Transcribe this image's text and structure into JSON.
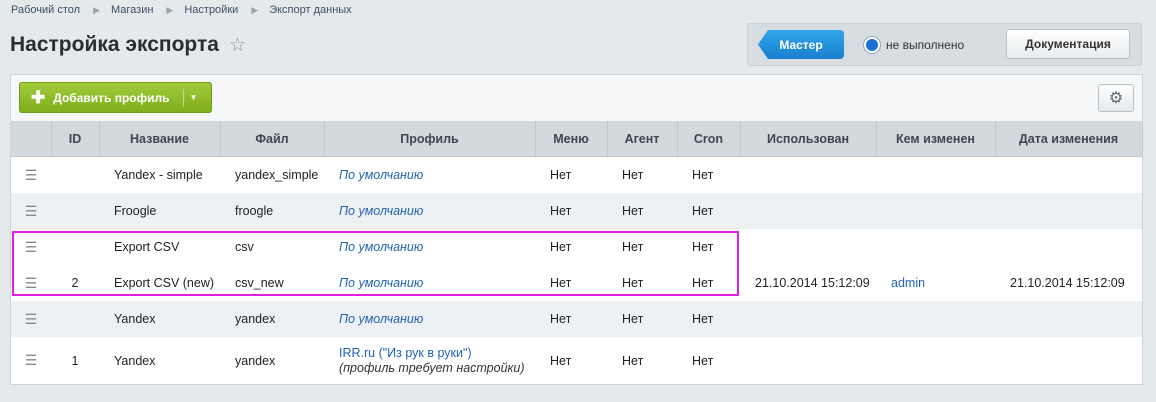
{
  "breadcrumb": [
    "Рабочий стол",
    "Магазин",
    "Настройки",
    "Экспорт данных"
  ],
  "page_title": "Настройка экспорта",
  "topbar": {
    "master_label": "Мастер",
    "status_label": "не выполнено",
    "doc_label": "Документация"
  },
  "toolbar": {
    "add_label": "Добавить профиль"
  },
  "columns": {
    "id": "ID",
    "name": "Название",
    "file": "Файл",
    "profile": "Профиль",
    "menu": "Меню",
    "agent": "Агент",
    "cron": "Cron",
    "used": "Использован",
    "changed_by": "Кем изменен",
    "changed_date": "Дата изменения"
  },
  "rows": [
    {
      "id": "",
      "name": "Yandex - simple",
      "file": "yandex_simple",
      "profile": "По умолчанию",
      "menu": "Нет",
      "agent": "Нет",
      "cron": "Нет",
      "used": "",
      "changed_by": "",
      "changed_date": ""
    },
    {
      "id": "",
      "name": "Froogle",
      "file": "froogle",
      "profile": "По умолчанию",
      "menu": "Нет",
      "agent": "Нет",
      "cron": "Нет",
      "used": "",
      "changed_by": "",
      "changed_date": ""
    },
    {
      "id": "",
      "name": "Export CSV",
      "file": "csv",
      "profile": "По умолчанию",
      "menu": "Нет",
      "agent": "Нет",
      "cron": "Нет",
      "used": "",
      "changed_by": "",
      "changed_date": ""
    },
    {
      "id": "2",
      "name": "Export CSV (new)",
      "file": "csv_new",
      "profile": "По умолчанию",
      "menu": "Нет",
      "agent": "Нет",
      "cron": "Нет",
      "used": "21.10.2014 15:12:09",
      "changed_by": "admin",
      "changed_date": "21.10.2014 15:12:09"
    },
    {
      "id": "",
      "name": "Yandex",
      "file": "yandex",
      "profile": "По умолчанию",
      "menu": "Нет",
      "agent": "Нет",
      "cron": "Нет",
      "used": "",
      "changed_by": "",
      "changed_date": ""
    },
    {
      "id": "1",
      "name": "Yandex",
      "file": "yandex",
      "profile": "IRR.ru (\"Из рук в руки\")",
      "profile_note": "(профиль требует настройки)",
      "menu": "Нет",
      "agent": "Нет",
      "cron": "Нет",
      "used": "",
      "changed_by": "",
      "changed_date": ""
    }
  ]
}
